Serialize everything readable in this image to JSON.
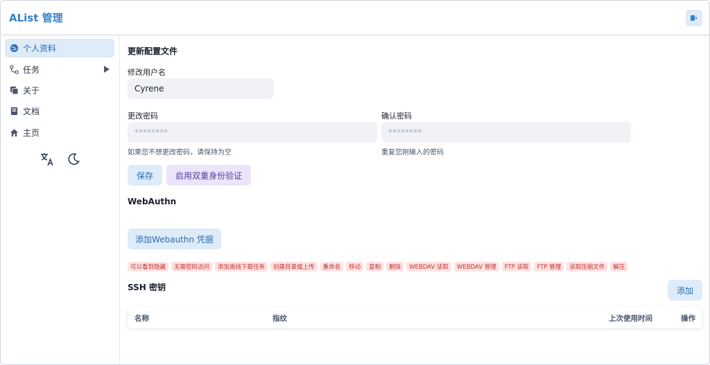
{
  "header": {
    "title": "AList 管理"
  },
  "sidebar": {
    "items": [
      {
        "label": "个人资料",
        "icon": "globe-icon",
        "active": true
      },
      {
        "label": "任务",
        "icon": "flow-icon",
        "has_submenu": true
      },
      {
        "label": "关于",
        "icon": "copy-icon"
      },
      {
        "label": "文档",
        "icon": "book-icon"
      },
      {
        "label": "主页",
        "icon": "home-icon"
      }
    ],
    "tools": [
      "translate-icon",
      "moon-icon"
    ]
  },
  "main": {
    "section_title": "更新配置文件",
    "username": {
      "label": "修改用户名",
      "value": "Cyrene"
    },
    "password": {
      "label": "更改密码",
      "placeholder": "********",
      "hint": "如果您不想更改密码，请保持为空"
    },
    "confirm": {
      "label": "确认密码",
      "placeholder": "********",
      "hint": "重复您刚输入的密码"
    },
    "save_button": "保存",
    "twofa_button": "启用双重身份验证",
    "webauthn_title": "WebAuthn",
    "webauthn_button": "添加Webauthn 凭据",
    "permissions": [
      "可以看到隐藏",
      "无需密码访问",
      "添加离线下载任务",
      "创建目录或上传",
      "重命名",
      "移动",
      "复制",
      "删除",
      "WEBDAV 读取",
      "WEBDAV 管理",
      "FTP 读取",
      "FTP 管理",
      "读取压缩文件",
      "解压"
    ],
    "ssh_title": "SSH 密钥",
    "ssh_add_button": "添加",
    "ssh_table": {
      "headers": [
        "名称",
        "指纹",
        "上次使用时间",
        "操作"
      ]
    }
  },
  "colors": {
    "accent": "#3182ce",
    "tag_bg": "#fde3e3",
    "tag_text": "#c53030"
  }
}
